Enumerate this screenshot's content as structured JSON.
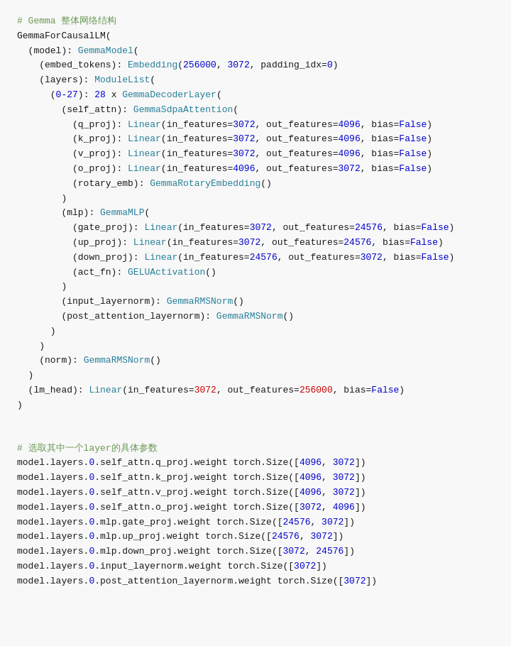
{
  "section1": {
    "comment": "# Gemma 整体网络结构",
    "lines": [
      {
        "text": "GemmaForCausalLM(",
        "parts": [
          {
            "t": "GemmaForCausalLM(",
            "cls": "plain"
          }
        ]
      },
      {
        "text": "  (model): GemmaModel(",
        "parts": [
          {
            "t": "  (model): ",
            "cls": "plain"
          },
          {
            "t": "GemmaModel",
            "cls": "class-name"
          },
          {
            "t": "(",
            "cls": "plain"
          }
        ]
      },
      {
        "text": "    (embed_tokens): Embedding(256000, 3072, padding_idx=0)",
        "parts": [
          {
            "t": "    (embed_tokens): ",
            "cls": "plain"
          },
          {
            "t": "Embedding",
            "cls": "class-name"
          },
          {
            "t": "(",
            "cls": "plain"
          },
          {
            "t": "256000",
            "cls": "param-value-blue"
          },
          {
            "t": ", ",
            "cls": "plain"
          },
          {
            "t": "3072",
            "cls": "param-value-blue"
          },
          {
            "t": ", padding_idx=",
            "cls": "plain"
          },
          {
            "t": "0",
            "cls": "param-value-blue"
          },
          {
            "t": ")",
            "cls": "plain"
          }
        ]
      },
      {
        "text": "    (layers): ModuleList(",
        "parts": [
          {
            "t": "    (layers): ",
            "cls": "plain"
          },
          {
            "t": "ModuleList",
            "cls": "class-name"
          },
          {
            "t": "(",
            "cls": "plain"
          }
        ]
      },
      {
        "text": "      (0-27): 28 x GemmaDecoderLayer(",
        "parts": [
          {
            "t": "      (",
            "cls": "plain"
          },
          {
            "t": "0-27",
            "cls": "param-value-blue"
          },
          {
            "t": "): ",
            "cls": "plain"
          },
          {
            "t": "28",
            "cls": "param-value-blue"
          },
          {
            "t": " x ",
            "cls": "plain"
          },
          {
            "t": "GemmaDecoderLayer",
            "cls": "class-name"
          },
          {
            "t": "(",
            "cls": "plain"
          }
        ]
      },
      {
        "text": "        (self_attn): GemmaSdpaAttention(",
        "parts": [
          {
            "t": "        (self_attn): ",
            "cls": "plain"
          },
          {
            "t": "GemmaSdpaAttention",
            "cls": "class-name"
          },
          {
            "t": "(",
            "cls": "plain"
          }
        ]
      },
      {
        "text": "          (q_proj): Linear(in_features=3072, out_features=4096, bias=False)",
        "parts": [
          {
            "t": "          (q_proj): ",
            "cls": "plain"
          },
          {
            "t": "Linear",
            "cls": "class-name"
          },
          {
            "t": "(in_features=",
            "cls": "plain"
          },
          {
            "t": "3072",
            "cls": "param-value-blue"
          },
          {
            "t": ", out_features=",
            "cls": "plain"
          },
          {
            "t": "4096",
            "cls": "param-value-blue"
          },
          {
            "t": ", bias=",
            "cls": "plain"
          },
          {
            "t": "False",
            "cls": "keyword-false"
          },
          {
            "t": ")",
            "cls": "plain"
          }
        ]
      },
      {
        "text": "          (k_proj): Linear(in_features=3072, out_features=4096, bias=False)",
        "parts": [
          {
            "t": "          (k_proj): ",
            "cls": "plain"
          },
          {
            "t": "Linear",
            "cls": "class-name"
          },
          {
            "t": "(in_features=",
            "cls": "plain"
          },
          {
            "t": "3072",
            "cls": "param-value-blue"
          },
          {
            "t": ", out_features=",
            "cls": "plain"
          },
          {
            "t": "4096",
            "cls": "param-value-blue"
          },
          {
            "t": ", bias=",
            "cls": "plain"
          },
          {
            "t": "False",
            "cls": "keyword-false"
          },
          {
            "t": ")",
            "cls": "plain"
          }
        ]
      },
      {
        "text": "          (v_proj): Linear(in_features=3072, out_features=4096, bias=False)",
        "parts": [
          {
            "t": "          (v_proj): ",
            "cls": "plain"
          },
          {
            "t": "Linear",
            "cls": "class-name"
          },
          {
            "t": "(in_features=",
            "cls": "plain"
          },
          {
            "t": "3072",
            "cls": "param-value-blue"
          },
          {
            "t": ", out_features=",
            "cls": "plain"
          },
          {
            "t": "4096",
            "cls": "param-value-blue"
          },
          {
            "t": ", bias=",
            "cls": "plain"
          },
          {
            "t": "False",
            "cls": "keyword-false"
          },
          {
            "t": ")",
            "cls": "plain"
          }
        ]
      },
      {
        "text": "          (o_proj): Linear(in_features=4096, out_features=3072, bias=False)",
        "parts": [
          {
            "t": "          (o_proj): ",
            "cls": "plain"
          },
          {
            "t": "Linear",
            "cls": "class-name"
          },
          {
            "t": "(in_features=",
            "cls": "plain"
          },
          {
            "t": "4096",
            "cls": "param-value-blue"
          },
          {
            "t": ", out_features=",
            "cls": "plain"
          },
          {
            "t": "3072",
            "cls": "param-value-blue"
          },
          {
            "t": ", bias=",
            "cls": "plain"
          },
          {
            "t": "False",
            "cls": "keyword-false"
          },
          {
            "t": ")",
            "cls": "plain"
          }
        ]
      },
      {
        "text": "          (rotary_emb): GemmaRotaryEmbedding()",
        "parts": [
          {
            "t": "          (rotary_emb): ",
            "cls": "plain"
          },
          {
            "t": "GemmaRotaryEmbedding",
            "cls": "class-name"
          },
          {
            "t": "()",
            "cls": "plain"
          }
        ]
      },
      {
        "text": "        )",
        "parts": [
          {
            "t": "        )",
            "cls": "plain"
          }
        ]
      },
      {
        "text": "        (mlp): GemmaMLP(",
        "parts": [
          {
            "t": "        (mlp): ",
            "cls": "plain"
          },
          {
            "t": "GemmaMLP",
            "cls": "class-name"
          },
          {
            "t": "(",
            "cls": "plain"
          }
        ]
      },
      {
        "text": "          (gate_proj): Linear(in_features=3072, out_features=24576, bias=False)",
        "parts": [
          {
            "t": "          (gate_proj): ",
            "cls": "plain"
          },
          {
            "t": "Linear",
            "cls": "class-name"
          },
          {
            "t": "(in_features=",
            "cls": "plain"
          },
          {
            "t": "3072",
            "cls": "param-value-blue"
          },
          {
            "t": ", out_features=",
            "cls": "plain"
          },
          {
            "t": "24576",
            "cls": "param-value-blue"
          },
          {
            "t": ", bias=",
            "cls": "plain"
          },
          {
            "t": "False",
            "cls": "keyword-false"
          },
          {
            "t": ")",
            "cls": "plain"
          }
        ]
      },
      {
        "text": "          (up_proj): Linear(in_features=3072, out_features=24576, bias=False)",
        "parts": [
          {
            "t": "          (up_proj): ",
            "cls": "plain"
          },
          {
            "t": "Linear",
            "cls": "class-name"
          },
          {
            "t": "(in_features=",
            "cls": "plain"
          },
          {
            "t": "3072",
            "cls": "param-value-blue"
          },
          {
            "t": ", out_features=",
            "cls": "plain"
          },
          {
            "t": "24576",
            "cls": "param-value-blue"
          },
          {
            "t": ", bias=",
            "cls": "plain"
          },
          {
            "t": "False",
            "cls": "keyword-false"
          },
          {
            "t": ")",
            "cls": "plain"
          }
        ]
      },
      {
        "text": "          (down_proj): Linear(in_features=24576, out_features=3072, bias=False)",
        "parts": [
          {
            "t": "          (down_proj): ",
            "cls": "plain"
          },
          {
            "t": "Linear",
            "cls": "class-name"
          },
          {
            "t": "(in_features=",
            "cls": "plain"
          },
          {
            "t": "24576",
            "cls": "param-value-blue"
          },
          {
            "t": ", out_features=",
            "cls": "plain"
          },
          {
            "t": "3072",
            "cls": "param-value-blue"
          },
          {
            "t": ", bias=",
            "cls": "plain"
          },
          {
            "t": "False",
            "cls": "keyword-false"
          },
          {
            "t": ")",
            "cls": "plain"
          }
        ]
      },
      {
        "text": "          (act_fn): GELUActivation()",
        "parts": [
          {
            "t": "          (act_fn): ",
            "cls": "plain"
          },
          {
            "t": "GELUActivation",
            "cls": "class-name"
          },
          {
            "t": "()",
            "cls": "plain"
          }
        ]
      },
      {
        "text": "        )",
        "parts": [
          {
            "t": "        )",
            "cls": "plain"
          }
        ]
      },
      {
        "text": "        (input_layernorm): GemmaRMSNorm()",
        "parts": [
          {
            "t": "        (input_layernorm): ",
            "cls": "plain"
          },
          {
            "t": "GemmaRMSNorm",
            "cls": "class-name"
          },
          {
            "t": "()",
            "cls": "plain"
          }
        ]
      },
      {
        "text": "        (post_attention_layernorm): GemmaRMSNorm()",
        "parts": [
          {
            "t": "        (post_attention_layernorm): ",
            "cls": "plain"
          },
          {
            "t": "GemmaRMSNorm",
            "cls": "class-name"
          },
          {
            "t": "()",
            "cls": "plain"
          }
        ]
      },
      {
        "text": "      )",
        "parts": [
          {
            "t": "      )",
            "cls": "plain"
          }
        ]
      },
      {
        "text": "    )",
        "parts": [
          {
            "t": "    )",
            "cls": "plain"
          }
        ]
      },
      {
        "text": "    (norm): GemmaRMSNorm()",
        "parts": [
          {
            "t": "    (norm): ",
            "cls": "plain"
          },
          {
            "t": "GemmaRMSNorm",
            "cls": "class-name"
          },
          {
            "t": "()",
            "cls": "plain"
          }
        ]
      },
      {
        "text": "  )",
        "parts": [
          {
            "t": "  )",
            "cls": "plain"
          }
        ]
      },
      {
        "text": "  (lm_head): Linear(in_features=3072, out_features=256000, bias=False)",
        "parts": [
          {
            "t": "  (lm_head): ",
            "cls": "plain"
          },
          {
            "t": "Linear",
            "cls": "class-name"
          },
          {
            "t": "(in_features=",
            "cls": "plain"
          },
          {
            "t": "3072",
            "cls": "param-value-red"
          },
          {
            "t": ", out_features=",
            "cls": "plain"
          },
          {
            "t": "256000",
            "cls": "param-value-red"
          },
          {
            "t": ", bias=",
            "cls": "plain"
          },
          {
            "t": "False",
            "cls": "keyword-false"
          },
          {
            "t": ")",
            "cls": "plain"
          }
        ]
      },
      {
        "text": ")",
        "parts": [
          {
            "t": ")",
            "cls": "plain"
          }
        ]
      }
    ]
  },
  "section2": {
    "comment": "# 选取其中一个layer的具体参数",
    "lines": [
      "model.layers.0.self_attn.q_proj.weight torch.Size([4096, 3072])",
      "model.layers.0.self_attn.k_proj.weight torch.Size([4096, 3072])",
      "model.layers.0.self_attn.v_proj.weight torch.Size([4096, 3072])",
      "model.layers.0.self_attn.o_proj.weight torch.Size([3072, 4096])",
      "model.layers.0.mlp.gate_proj.weight torch.Size([24576, 3072])",
      "model.layers.0.mlp.up_proj.weight torch.Size([24576, 3072])",
      "model.layers.0.mlp.down_proj.weight torch.Size([3072, 24576])",
      "model.layers.0.input_layernorm.weight torch.Size([3072])",
      "model.layers.0.post_attention_layernorm.weight torch.Size([3072])"
    ],
    "line_parts": [
      [
        {
          "t": "model.layers.",
          "cls": "plain"
        },
        {
          "t": "0",
          "cls": "param-value-blue"
        },
        {
          "t": ".self_attn.q_proj.weight torch.Size([",
          "cls": "plain"
        },
        {
          "t": "4096",
          "cls": "param-value-blue"
        },
        {
          "t": ", ",
          "cls": "plain"
        },
        {
          "t": "3072",
          "cls": "param-value-blue"
        },
        {
          "t": "])",
          "cls": "plain"
        }
      ],
      [
        {
          "t": "model.layers.",
          "cls": "plain"
        },
        {
          "t": "0",
          "cls": "param-value-blue"
        },
        {
          "t": ".self_attn.k_proj.weight torch.Size([",
          "cls": "plain"
        },
        {
          "t": "4096",
          "cls": "param-value-blue"
        },
        {
          "t": ", ",
          "cls": "plain"
        },
        {
          "t": "3072",
          "cls": "param-value-blue"
        },
        {
          "t": "])",
          "cls": "plain"
        }
      ],
      [
        {
          "t": "model.layers.",
          "cls": "plain"
        },
        {
          "t": "0",
          "cls": "param-value-blue"
        },
        {
          "t": ".self_attn.v_proj.weight torch.Size([",
          "cls": "plain"
        },
        {
          "t": "4096",
          "cls": "param-value-blue"
        },
        {
          "t": ", ",
          "cls": "plain"
        },
        {
          "t": "3072",
          "cls": "param-value-blue"
        },
        {
          "t": "])",
          "cls": "plain"
        }
      ],
      [
        {
          "t": "model.layers.",
          "cls": "plain"
        },
        {
          "t": "0",
          "cls": "param-value-blue"
        },
        {
          "t": ".self_attn.o_proj.weight torch.Size([",
          "cls": "plain"
        },
        {
          "t": "3072",
          "cls": "param-value-blue"
        },
        {
          "t": ", ",
          "cls": "plain"
        },
        {
          "t": "4096",
          "cls": "param-value-blue"
        },
        {
          "t": "])",
          "cls": "plain"
        }
      ],
      [
        {
          "t": "model.layers.",
          "cls": "plain"
        },
        {
          "t": "0",
          "cls": "param-value-blue"
        },
        {
          "t": ".mlp.gate_proj.weight torch.Size([",
          "cls": "plain"
        },
        {
          "t": "24576",
          "cls": "param-value-blue"
        },
        {
          "t": ", ",
          "cls": "plain"
        },
        {
          "t": "3072",
          "cls": "param-value-blue"
        },
        {
          "t": "])",
          "cls": "plain"
        }
      ],
      [
        {
          "t": "model.layers.",
          "cls": "plain"
        },
        {
          "t": "0",
          "cls": "param-value-blue"
        },
        {
          "t": ".mlp.up_proj.weight torch.Size([",
          "cls": "plain"
        },
        {
          "t": "24576",
          "cls": "param-value-blue"
        },
        {
          "t": ", ",
          "cls": "plain"
        },
        {
          "t": "3072",
          "cls": "param-value-blue"
        },
        {
          "t": "])",
          "cls": "plain"
        }
      ],
      [
        {
          "t": "model.layers.",
          "cls": "plain"
        },
        {
          "t": "0",
          "cls": "param-value-blue"
        },
        {
          "t": ".mlp.down_proj.weight torch.Size([",
          "cls": "plain"
        },
        {
          "t": "3072",
          "cls": "param-value-blue"
        },
        {
          "t": ", ",
          "cls": "plain"
        },
        {
          "t": "24576",
          "cls": "param-value-blue"
        },
        {
          "t": "])",
          "cls": "plain"
        }
      ],
      [
        {
          "t": "model.layers.",
          "cls": "plain"
        },
        {
          "t": "0",
          "cls": "param-value-blue"
        },
        {
          "t": ".input_layernorm.weight torch.Size([",
          "cls": "plain"
        },
        {
          "t": "3072",
          "cls": "param-value-blue"
        },
        {
          "t": "])",
          "cls": "plain"
        }
      ],
      [
        {
          "t": "model.layers.",
          "cls": "plain"
        },
        {
          "t": "0",
          "cls": "param-value-blue"
        },
        {
          "t": ".post_attention_layernorm.weight torch.Size([",
          "cls": "plain"
        },
        {
          "t": "3072",
          "cls": "param-value-blue"
        },
        {
          "t": "])",
          "cls": "plain"
        }
      ]
    ]
  }
}
